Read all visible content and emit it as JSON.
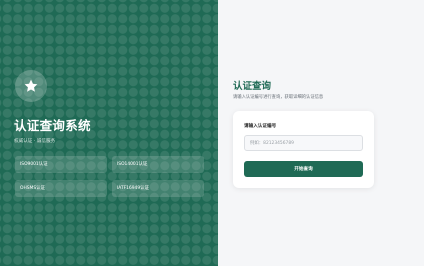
{
  "left_panel": {
    "logo_icon": "star-icon",
    "title": "认证查询系统",
    "subtitle": "权威认证 · 诚信服务",
    "certifications": [
      "ISO9001认证",
      "ISO14001认证",
      "OHSMS认证",
      "IATF16949认证"
    ]
  },
  "right_panel": {
    "title": "认证查询",
    "subtitle": "请输入认证编号进行查询，获取详细的认证信息",
    "form": {
      "label": "请输入认证编号",
      "placeholder": "例如：82123456789",
      "value": "",
      "button_label": "开始查询"
    }
  },
  "colors": {
    "brand": "#1f6a55",
    "background": "#f5f6f8"
  }
}
